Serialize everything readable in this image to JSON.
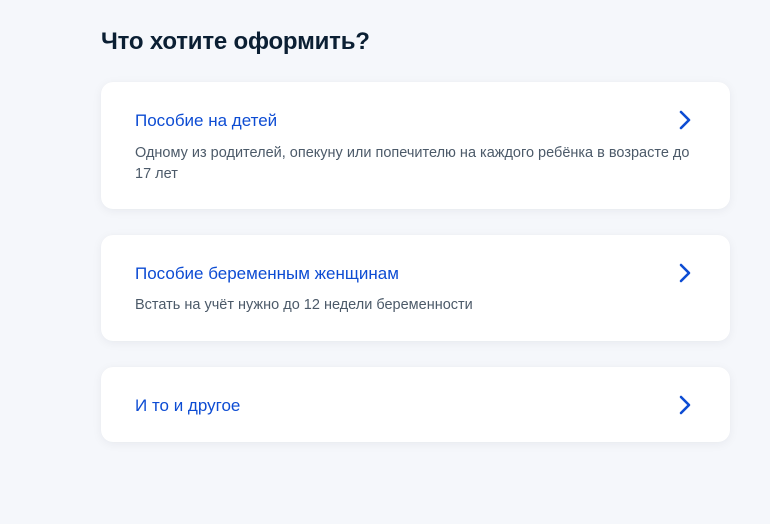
{
  "page": {
    "title": "Что хотите оформить?"
  },
  "options": [
    {
      "title": "Пособие на детей",
      "description": "Одному из родителей, опекуну или попечителю на каждого ребёнка в возрасте до 17 лет",
      "icon": "chevron-right-icon"
    },
    {
      "title": "Пособие беременным женщинам",
      "description": "Встать на учёт нужно до 12 недели беременности",
      "icon": "chevron-right-icon"
    },
    {
      "title": "И то и другое",
      "icon": "chevron-right-icon"
    }
  ],
  "colors": {
    "background": "#f5f7fb",
    "card": "#ffffff",
    "title": "#0b1f33",
    "link": "#0d4cd3",
    "description": "#4c5a69"
  }
}
